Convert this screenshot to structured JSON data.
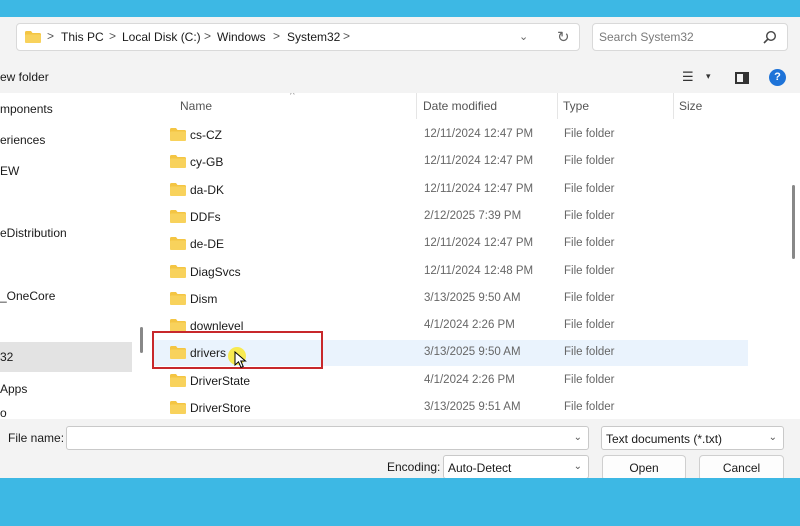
{
  "address": {
    "crumbs": [
      "This PC",
      "Local Disk (C:)",
      "Windows",
      "System32"
    ],
    "separator": ">",
    "dropdown_glyph": "⌄",
    "refresh_glyph": "↻"
  },
  "search": {
    "placeholder": "Search System32",
    "icon": "search-icon"
  },
  "toolbar": {
    "new_folder_label": "ew folder",
    "view_glyph": "☰",
    "view_dd": "▾",
    "help_label": "?"
  },
  "nav": {
    "items": [
      {
        "label": "mponents"
      },
      {
        "label": "eriences"
      },
      {
        "label": "EW"
      },
      {
        "label": "eDistribution"
      },
      {
        "label": "_OneCore"
      },
      {
        "label": "32",
        "selected": true
      },
      {
        "label": "Apps"
      },
      {
        "label": "o"
      }
    ]
  },
  "columns": {
    "name": "Name",
    "date": "Date modified",
    "type": "Type",
    "size": "Size"
  },
  "files": [
    {
      "name": "cs-CZ",
      "date": "12/11/2024 12:47 PM",
      "type": "File folder"
    },
    {
      "name": "cy-GB",
      "date": "12/11/2024 12:47 PM",
      "type": "File folder"
    },
    {
      "name": "da-DK",
      "date": "12/11/2024 12:47 PM",
      "type": "File folder"
    },
    {
      "name": "DDFs",
      "date": "2/12/2025 7:39 PM",
      "type": "File folder"
    },
    {
      "name": "de-DE",
      "date": "12/11/2024 12:47 PM",
      "type": "File folder"
    },
    {
      "name": "DiagSvcs",
      "date": "12/11/2024 12:48 PM",
      "type": "File folder"
    },
    {
      "name": "Dism",
      "date": "3/13/2025 9:50 AM",
      "type": "File folder"
    },
    {
      "name": "downlevel",
      "date": "4/1/2024 2:26 PM",
      "type": "File folder"
    },
    {
      "name": "drivers",
      "date": "3/13/2025 9:50 AM",
      "type": "File folder",
      "hover": true
    },
    {
      "name": "DriverState",
      "date": "4/1/2024 2:26 PM",
      "type": "File folder"
    },
    {
      "name": "DriverStore",
      "date": "3/13/2025 9:51 AM",
      "type": "File folder"
    }
  ],
  "footer": {
    "file_name_label": "File name:",
    "file_name_value": "",
    "file_type_value": "Text documents (*.txt)",
    "encoding_label": "Encoding:",
    "encoding_value": "Auto-Detect",
    "open_label": "Open",
    "cancel_label": "Cancel",
    "dd_glyph": "⌄"
  },
  "colors": {
    "accent": "#1e6fd9",
    "highlight_box": "#c8282b",
    "folder": "#f4c543",
    "row_hover": "#eaf3fd",
    "backdrop": "#3db8e4"
  }
}
